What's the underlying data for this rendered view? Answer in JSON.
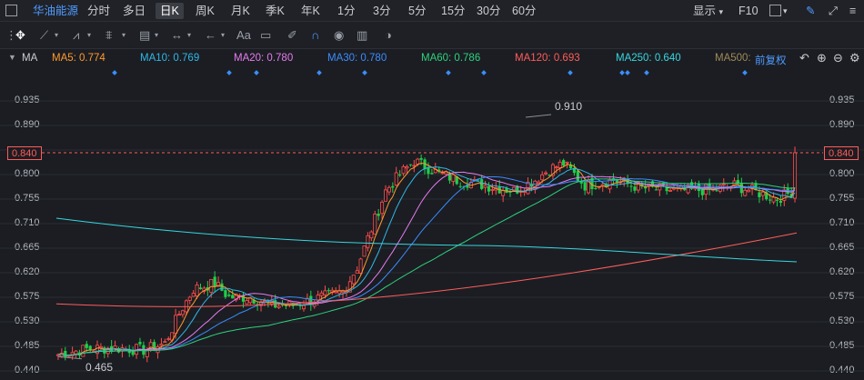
{
  "topbar": {
    "stock_name": "华油能源",
    "periods": [
      "分时",
      "多日",
      "日K",
      "周K",
      "月K",
      "季K",
      "年K",
      "1分",
      "3分",
      "5分",
      "15分",
      "30分",
      "60分"
    ],
    "active_period": "日K",
    "display_label": "显示",
    "f10_label": "F10"
  },
  "toolbar": {
    "text_tool": "Aa"
  },
  "indicators": {
    "label": "MA",
    "items": [
      {
        "text": "MA5: 0.774",
        "color": "#ff9a2e"
      },
      {
        "text": "MA10: 0.769",
        "color": "#2fb7e8"
      },
      {
        "text": "MA20: 0.780",
        "color": "#e57bf0"
      },
      {
        "text": "MA30: 0.780",
        "color": "#3b8cff"
      },
      {
        "text": "MA60: 0.786",
        "color": "#2fd17e"
      },
      {
        "text": "MA120: 0.693",
        "color": "#ff5c5c"
      },
      {
        "text": "MA250: 0.640",
        "color": "#37d6e0"
      },
      {
        "text": "MA500:",
        "color": "#a08a5a"
      }
    ],
    "adjust_label": "前复权"
  },
  "axis": {
    "ticks": [
      "0.935",
      "0.890",
      "0.845",
      "0.800",
      "0.755",
      "0.710",
      "0.665",
      "0.620",
      "0.575",
      "0.530",
      "0.485",
      "0.440"
    ],
    "current_price": "0.840"
  },
  "annotations": {
    "high": "0.910",
    "low": "0.465"
  },
  "colors": {
    "up": "#ff4d4d",
    "down": "#1fcf4a",
    "background": "#1b1d22"
  }
}
